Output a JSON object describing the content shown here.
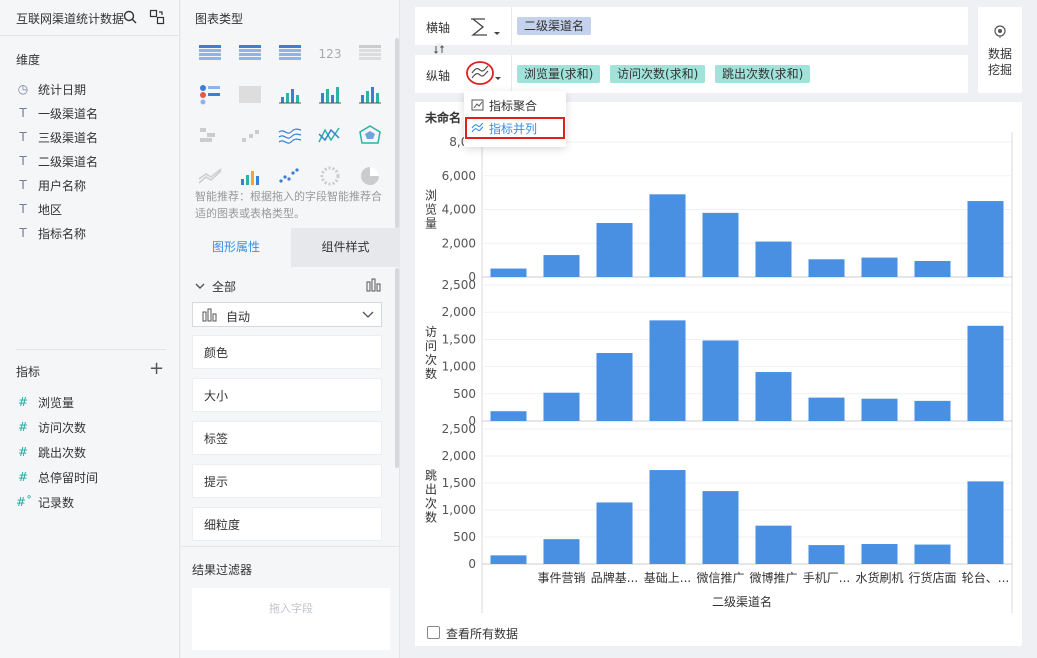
{
  "left": {
    "title": "互联网渠道统计数据",
    "dimension_header": "维度",
    "dimensions": [
      {
        "icon": "clock-icon",
        "glyph": "◷",
        "label": "统计日期"
      },
      {
        "icon": "text-icon",
        "glyph": "T",
        "label": "一级渠道名"
      },
      {
        "icon": "text-icon",
        "glyph": "T",
        "label": "三级渠道名"
      },
      {
        "icon": "text-icon",
        "glyph": "T",
        "label": "二级渠道名"
      },
      {
        "icon": "text-icon",
        "glyph": "T",
        "label": "用户名称"
      },
      {
        "icon": "text-icon",
        "glyph": "T",
        "label": "地区"
      },
      {
        "icon": "text-icon",
        "glyph": "T",
        "label": "指标名称"
      }
    ],
    "metric_header": "指标",
    "metrics": [
      {
        "glyph": "#",
        "label": "浏览量"
      },
      {
        "glyph": "#",
        "label": "访问次数"
      },
      {
        "glyph": "#",
        "label": "跳出次数"
      },
      {
        "glyph": "#",
        "label": "总停留时间"
      },
      {
        "glyph": "#˚",
        "label": "记录数"
      }
    ]
  },
  "middle": {
    "chart_type_header": "图表类型",
    "smart_hint": "智能推荐：根据拖入的字段智能推荐合适的图表或表格类型。",
    "tab_graphic": "图形属性",
    "tab_component": "组件样式",
    "all_label": "全部",
    "auto_label": "自动",
    "props": [
      "颜色",
      "大小",
      "标签",
      "提示",
      "细粒度"
    ],
    "filter_header": "结果过滤器",
    "drop_placeholder": "拖入字段"
  },
  "axes": {
    "x_label": "横轴",
    "x_fields": [
      "二级渠道名"
    ],
    "y_label": "纵轴",
    "y_fields": [
      "浏览量(求和)",
      "访问次数(求和)",
      "跳出次数(求和)"
    ],
    "data_mining": "数据挖掘"
  },
  "dropdown": {
    "items": [
      "指标聚合",
      "指标并列"
    ],
    "selected": "指标并列"
  },
  "colors": {
    "accent": "#3a8ee6",
    "bar": "#4a90e2",
    "x_pill": "#c4d2ee",
    "y_pill": "#9fe3da",
    "highlight": "#e02020"
  },
  "chart": {
    "title": "未命名",
    "view_all": "查看所有数据"
  },
  "chart_data": {
    "type": "bar",
    "xlabel": "二级渠道名",
    "categories": [
      "",
      "事件营销",
      "品牌基...",
      "基础上...",
      "微信推广",
      "微博推广",
      "手机厂...",
      "水货刷机",
      "行货店面",
      "轮台、..."
    ],
    "series": [
      {
        "name": "浏览量",
        "ylabel": "浏览量",
        "yticks": [
          "0",
          "2,000",
          "4,000",
          "6,000",
          "8,00"
        ],
        "ylim": [
          0,
          8000
        ],
        "values": [
          500,
          1300,
          3200,
          4900,
          3800,
          2100,
          1050,
          1150,
          950,
          4500
        ]
      },
      {
        "name": "访问次数",
        "ylabel": "访问次数",
        "yticks": [
          "0",
          "500",
          "1,000",
          "1,500",
          "2,000",
          "2,500"
        ],
        "ylim": [
          0,
          2500
        ],
        "values": [
          180,
          520,
          1250,
          1850,
          1480,
          900,
          430,
          410,
          370,
          1750
        ]
      },
      {
        "name": "跳出次数",
        "ylabel": "跳出次数",
        "yticks": [
          "0",
          "500",
          "1,000",
          "1,500",
          "2,000",
          "2,500"
        ],
        "ylim": [
          0,
          2500
        ],
        "values": [
          160,
          460,
          1140,
          1740,
          1350,
          710,
          350,
          370,
          360,
          1530
        ]
      }
    ]
  }
}
